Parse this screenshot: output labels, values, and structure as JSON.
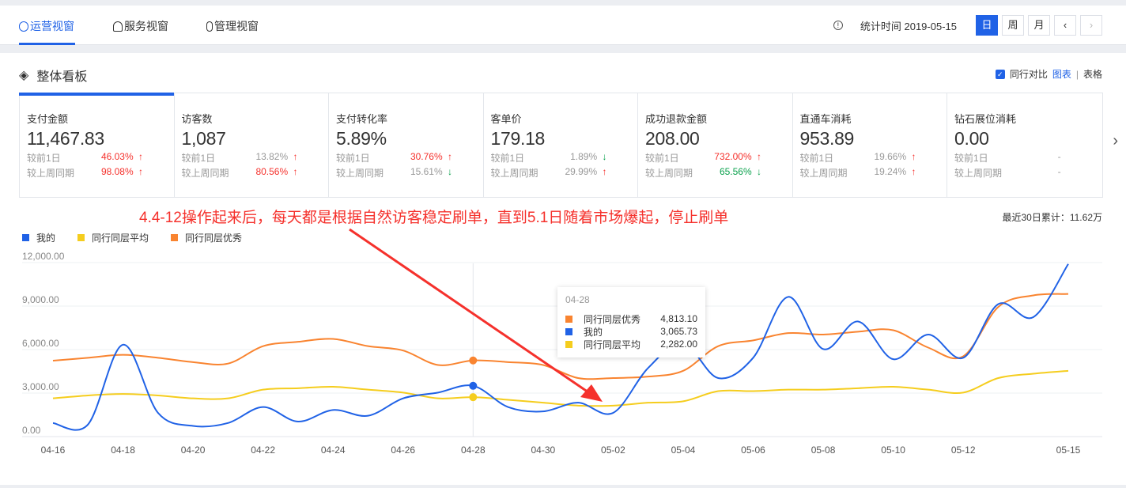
{
  "tabs": [
    {
      "label": "运营视窗",
      "active": true
    },
    {
      "label": "服务视窗"
    },
    {
      "label": "管理视窗"
    }
  ],
  "header": {
    "stat_time": "统计时间 2019-05-15",
    "periods": [
      "日",
      "周",
      "月"
    ],
    "prev": "‹",
    "next": "›",
    "info_icon": "!"
  },
  "panel": {
    "title": "整体看板",
    "compare_label": "同行对比",
    "view_chart": "图表",
    "sep": "|",
    "view_table": "表格"
  },
  "cards": [
    {
      "name": "支付金额",
      "value": "11,467.83",
      "d1_label": "较前1日",
      "d1": "46.03%",
      "d1_dir": "up",
      "d1_color": "red",
      "w_label": "较上周同期",
      "w": "98.08%",
      "w_dir": "up",
      "w_color": "red"
    },
    {
      "name": "访客数",
      "value": "1,087",
      "d1_label": "较前1日",
      "d1": "13.82%",
      "d1_dir": "up",
      "d1_color": "gray",
      "w_label": "较上周同期",
      "w": "80.56%",
      "w_dir": "up",
      "w_color": "red"
    },
    {
      "name": "支付转化率",
      "value": "5.89%",
      "d1_label": "较前1日",
      "d1": "30.76%",
      "d1_dir": "up",
      "d1_color": "red",
      "w_label": "较上周同期",
      "w": "15.61%",
      "w_dir": "down",
      "w_color": "gray"
    },
    {
      "name": "客单价",
      "value": "179.18",
      "d1_label": "较前1日",
      "d1": "1.89%",
      "d1_dir": "down",
      "d1_color": "gray",
      "w_label": "较上周同期",
      "w": "29.99%",
      "w_dir": "up",
      "w_color": "gray"
    },
    {
      "name": "成功退款金额",
      "value": "208.00",
      "d1_label": "较前1日",
      "d1": "732.00%",
      "d1_dir": "up",
      "d1_color": "red",
      "w_label": "较上周同期",
      "w": "65.56%",
      "w_dir": "down",
      "w_color": "green"
    },
    {
      "name": "直通车消耗",
      "value": "953.89",
      "d1_label": "较前1日",
      "d1": "19.66%",
      "d1_dir": "up",
      "d1_color": "gray",
      "w_label": "较上周同期",
      "w": "19.24%",
      "w_dir": "up",
      "w_color": "gray"
    },
    {
      "name": "钻石展位消耗",
      "value": "0.00",
      "d1_label": "较前1日",
      "d1": "-",
      "d1_dir": "none",
      "d1_color": "gray",
      "w_label": "较上周同期",
      "w": "-",
      "w_dir": "none",
      "w_color": "gray"
    }
  ],
  "annotation": "4.4-12操作起来后，每天都是根据自然访客稳定刷单，直到5.1日随着市场爆起，停止刷单",
  "total": "最近30日累计：11.62万",
  "tooltip": {
    "date": "04-28",
    "rows": [
      {
        "name": "同行同层优秀",
        "value": "4,813.10",
        "color": "#f98430"
      },
      {
        "name": "我的",
        "value": "3,065.73",
        "color": "#2062e6"
      },
      {
        "name": "同行同层平均",
        "value": "2,282.00",
        "color": "#f5cd1e"
      }
    ]
  },
  "chart_data": {
    "type": "line",
    "x": [
      "04-16",
      "04-17",
      "04-18",
      "04-19",
      "04-20",
      "04-21",
      "04-22",
      "04-23",
      "04-24",
      "04-25",
      "04-26",
      "04-27",
      "04-28",
      "04-29",
      "04-30",
      "05-01",
      "05-02",
      "05-03",
      "05-04",
      "05-05",
      "05-06",
      "05-07",
      "05-08",
      "05-09",
      "05-10",
      "05-11",
      "05-12",
      "05-13",
      "05-14",
      "05-15"
    ],
    "xticks": [
      "04-16",
      "04-18",
      "04-20",
      "04-22",
      "04-24",
      "04-26",
      "04-28",
      "04-30",
      "05-02",
      "05-04",
      "05-06",
      "05-08",
      "05-10",
      "05-12",
      "05-15"
    ],
    "yticks": [
      "0.00",
      "3,000.00",
      "6,000.00",
      "9,000.00",
      "12,000.00"
    ],
    "ylim": [
      0,
      12000
    ],
    "legend_position": "top-left",
    "highlight": "04-28",
    "series": [
      {
        "name": "我的",
        "color": "#2062e6",
        "values": [
          500,
          400,
          5900,
          1200,
          300,
          500,
          1600,
          600,
          1400,
          1000,
          2200,
          2600,
          3065.73,
          1600,
          1300,
          1900,
          1200,
          4300,
          6000,
          3600,
          5000,
          9200,
          5600,
          7500,
          4900,
          6600,
          5000,
          8700,
          7800,
          11467.83
        ]
      },
      {
        "name": "同行同层平均",
        "color": "#f5cd1e",
        "values": [
          2200,
          2400,
          2500,
          2400,
          2200,
          2200,
          2800,
          2900,
          3000,
          2800,
          2600,
          2200,
          2282,
          2100,
          1900,
          1700,
          1700,
          1900,
          2000,
          2700,
          2700,
          2800,
          2800,
          2900,
          3000,
          2800,
          2600,
          3600,
          3900,
          4100
        ]
      },
      {
        "name": "同行同层优秀",
        "color": "#f98430",
        "values": [
          4800,
          5000,
          5200,
          5000,
          4700,
          4600,
          5800,
          6100,
          6300,
          5800,
          5500,
          4500,
          4813.1,
          4700,
          4500,
          3600,
          3600,
          3700,
          4100,
          5800,
          6200,
          6700,
          6600,
          6800,
          6900,
          5700,
          5100,
          8500,
          9300,
          9400
        ]
      }
    ]
  }
}
